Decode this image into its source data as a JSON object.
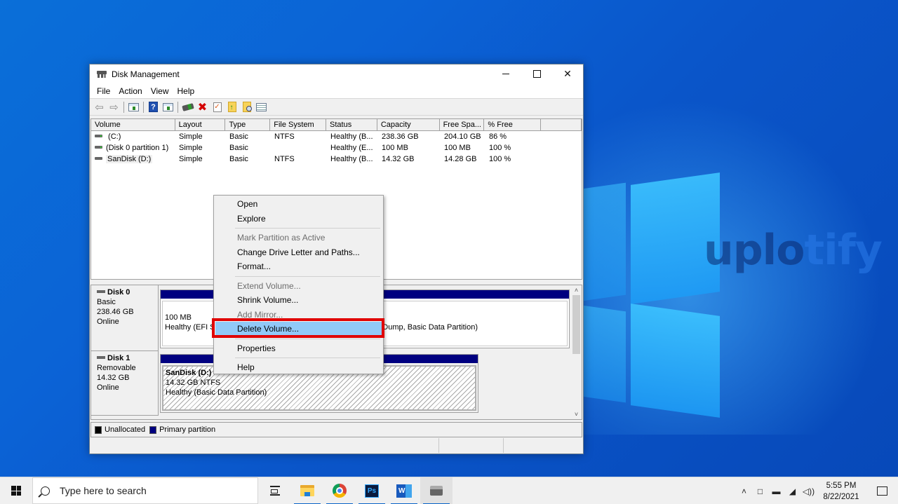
{
  "window": {
    "title": "Disk Management",
    "controls": {
      "minimize": "minimize",
      "maximize": "maximize",
      "close": "✕"
    }
  },
  "menubar": [
    "File",
    "Action",
    "View",
    "Help"
  ],
  "toolbar": {
    "icons": [
      "back-arrow-icon",
      "forward-arrow-icon",
      "show-hide-console-tree-icon",
      "help-icon",
      "show-hide-action-pane-icon",
      "connect-disk-icon",
      "delete-icon",
      "properties-check-icon",
      "folder-up-icon",
      "folder-search-icon",
      "list-view-icon"
    ]
  },
  "volume_list": {
    "columns": [
      "Volume",
      "Layout",
      "Type",
      "File System",
      "Status",
      "Capacity",
      "Free Spa...",
      "% Free",
      ""
    ],
    "rows": [
      {
        "volume": " (C:)",
        "layout": "Simple",
        "type": "Basic",
        "fs": "NTFS",
        "status": "Healthy (B...",
        "capacity": "238.36 GB",
        "free": "204.10 GB",
        "pct": "86 %"
      },
      {
        "volume": "(Disk 0 partition 1)",
        "layout": "Simple",
        "type": "Basic",
        "fs": "",
        "status": "Healthy (E...",
        "capacity": "100 MB",
        "free": "100 MB",
        "pct": "100 %"
      },
      {
        "volume": "SanDisk (D:)",
        "layout": "Simple",
        "type": "Basic",
        "fs": "NTFS",
        "status": "Healthy (B...",
        "capacity": "14.32 GB",
        "free": "14.28 GB",
        "pct": "100 %"
      }
    ]
  },
  "disks": [
    {
      "name": "Disk 0",
      "kind": "Basic",
      "size": "238.46 GB",
      "state": "Online",
      "partitions": [
        {
          "line1": "100 MB",
          "line2": "Healthy (EFI S"
        },
        {
          "line1": "",
          "line2": "Dump, Basic Data Partition)"
        }
      ]
    },
    {
      "name": "Disk 1",
      "kind": "Removable",
      "size": "14.32 GB",
      "state": "Online",
      "partitions": [
        {
          "title": "SanDisk  (D:)",
          "line1": "14.32 GB NTFS",
          "line2": "Healthy (Basic Data Partition)"
        }
      ]
    }
  ],
  "legend": [
    {
      "label": "Unallocated",
      "color": "#000000"
    },
    {
      "label": "Primary partition",
      "color": "#000080"
    }
  ],
  "context_menu": {
    "items": [
      {
        "label": "Open",
        "enabled": true
      },
      {
        "label": "Explore",
        "enabled": true
      },
      {
        "label": "Mark Partition as Active",
        "enabled": false
      },
      {
        "label": "Change Drive Letter and Paths...",
        "enabled": true
      },
      {
        "label": "Format...",
        "enabled": true
      },
      {
        "label": "Extend Volume...",
        "enabled": false
      },
      {
        "label": "Shrink Volume...",
        "enabled": true
      },
      {
        "label": "Add Mirror...",
        "enabled": false
      },
      {
        "label": "Delete Volume...",
        "enabled": true,
        "highlighted": true
      },
      {
        "label": "Properties",
        "enabled": true
      },
      {
        "label": "Help",
        "enabled": true
      }
    ],
    "highlight_color": "#e00000"
  },
  "watermark": {
    "dark": "uplo",
    "light": "tify"
  },
  "taskbar": {
    "search_placeholder": "Type here to search",
    "apps": [
      "task-view",
      "file-explorer",
      "chrome",
      "photoshop",
      "word",
      "disk-management"
    ],
    "ps_label": "Ps",
    "word_label": "W",
    "time": "5:55 PM",
    "date": "8/22/2021",
    "tray": [
      "˄",
      "□",
      "▬",
      "◢",
      "◁))"
    ]
  }
}
